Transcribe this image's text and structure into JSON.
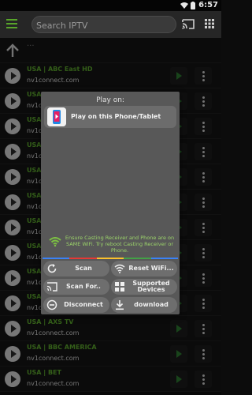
{
  "status_bar": {
    "time": "6:57"
  },
  "toolbar": {
    "search_placeholder": "Search IPTV"
  },
  "up_row": {
    "label": "..."
  },
  "channels": [
    {
      "name": "USA | ABC East HD",
      "url": "nv1connect.com"
    },
    {
      "name": "USA",
      "url": "nv1c"
    },
    {
      "name": "USA",
      "url": "nv1c"
    },
    {
      "name": "USA",
      "url": "nv1c"
    },
    {
      "name": "USA",
      "url": "nv1c"
    },
    {
      "name": "USA",
      "url": "nv1c"
    },
    {
      "name": "USA",
      "url": "nv1c"
    },
    {
      "name": "USA",
      "url": "nv1c"
    },
    {
      "name": "USA",
      "url": "nv1c"
    },
    {
      "name": "USA",
      "url": "nv1c"
    },
    {
      "name": "USA | AXS TV",
      "url": "nv1connect.com"
    },
    {
      "name": "USA | BBC AMERICA",
      "url": "nv1connect.com"
    },
    {
      "name": "USA | BET",
      "url": "nv1connect.com"
    }
  ],
  "cast_dialog": {
    "title": "Play on:",
    "device_label": "Play on this Phone/Tablet",
    "tip": "Ensure Casting Receiver and Phone are on SAME WiFi. Try reboot Casting Receiver or Phone.",
    "buttons": {
      "scan": "Scan",
      "reset_wifi": "Reset WiFi...",
      "scan_for": "Scan For..",
      "supported_devices": "Supported Devices",
      "disconnect": "Disconnect",
      "download": "download"
    },
    "colors": [
      "#3b82f6",
      "#e53935",
      "#fbc02d",
      "#43a047",
      "#3b82f6"
    ]
  },
  "icons": {
    "menu": "menu-icon",
    "cast": "cast-icon",
    "grid": "grid-icon",
    "up": "arrow-up-icon",
    "wifi": "wifi-icon"
  }
}
